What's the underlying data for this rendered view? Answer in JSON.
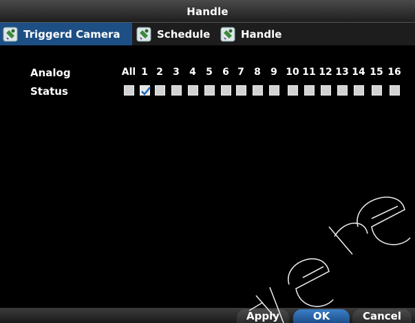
{
  "window": {
    "title": "Handle"
  },
  "tabs": [
    {
      "label": "Triggerd Camera",
      "icon": "camera-settings-icon",
      "active": true
    },
    {
      "label": "Schedule",
      "icon": "camera-settings-icon",
      "active": false
    },
    {
      "label": "Handle",
      "icon": "camera-settings-icon",
      "active": false
    }
  ],
  "grid": {
    "row1_label": "Analog",
    "row2_label": "Status",
    "columns": [
      "All",
      "1",
      "2",
      "3",
      "4",
      "5",
      "6",
      "7",
      "8",
      "9",
      "10",
      "11",
      "12",
      "13",
      "14",
      "15",
      "16"
    ],
    "checked": [
      false,
      true,
      false,
      false,
      false,
      false,
      false,
      false,
      false,
      false,
      false,
      false,
      false,
      false,
      false,
      false,
      false
    ]
  },
  "footer": {
    "apply_label": "Apply",
    "ok_label": "OK",
    "cancel_label": "Cancel"
  },
  "colors": {
    "accent": "#1e4f84",
    "background": "#000000",
    "checkmark": "#1565c0"
  }
}
